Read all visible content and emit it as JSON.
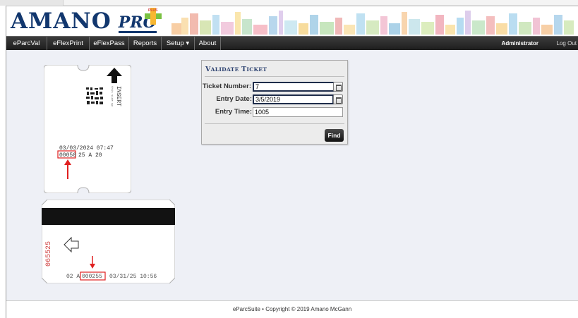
{
  "header": {
    "logo_main": "AMANO",
    "logo_pro": "PRO",
    "logo_plus": "PLUS"
  },
  "nav": {
    "items": [
      {
        "label": "eParcVal"
      },
      {
        "label": "eFlexPrint"
      },
      {
        "label": "eFlexPass"
      },
      {
        "label": "Reports"
      },
      {
        "label": "Setup ▾"
      },
      {
        "label": "About"
      }
    ],
    "user": "Administrator",
    "logout": "Log Out"
  },
  "ticket_front": {
    "insert_label": "INSERT",
    "insert_sub": "this side up",
    "date_time": "03/03/2024 07:47",
    "number": "00050",
    "code": "25 A 20"
  },
  "ticket_back": {
    "side_number": "065525",
    "prefix": "02 A",
    "number": "000255",
    "date_time": "03/31/25 10:56"
  },
  "validate": {
    "title_first": "V",
    "title_rest": "ALIDATE",
    "title_first2": "T",
    "title_rest2": "ICKET",
    "ticket_label": "Ticket Number:",
    "ticket_value": "7",
    "entry_date_label": "Entry Date:",
    "entry_date_value": "3/5/2019",
    "entry_time_label": "Entry Time:",
    "entry_time_value": "1005",
    "find_label": "Find"
  },
  "footer": {
    "text": "eParcSuite • Copyright © 2019 Amano McGann"
  },
  "colors": {
    "brand_navy": "#12376e",
    "nav_bg": "#1d1d1d",
    "highlight_red": "#e02020"
  }
}
